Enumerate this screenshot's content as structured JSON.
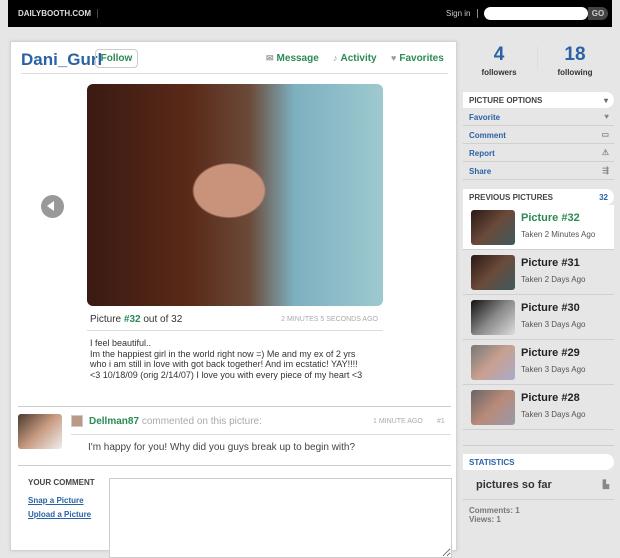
{
  "topbar": {
    "logo": "DAILYBOOTH.COM",
    "signin": "Sign in",
    "search_placeholder": "",
    "go": "GO"
  },
  "profile": {
    "username": "Dani_Gurl",
    "follow": "Follow",
    "nav": {
      "message": "Message",
      "activity": "Activity",
      "favorites": "Favorites"
    }
  },
  "picture": {
    "prefix": "Picture",
    "number": "#32",
    "suffix": "out of 32",
    "ago": "2 MINUTES 5 SECONDS AGO",
    "caption": [
      "I feel beautiful..",
      "Im the happiest girl in the world right now =) Me and my ex of 2 yrs",
      "who i am still in love with got back together! And im ecstatic! YAY!!!!",
      "<3 10/18/09 (orig 2/14/07) I love you with every piece of my heart <3"
    ]
  },
  "comment": {
    "user": "Dellman87",
    "action": "commented on this picture:",
    "ago": "1 MINUTE AGO",
    "num": "#1",
    "text": "I'm happy for you! Why did you guys break up to begin with?"
  },
  "your_comment": {
    "title": "YOUR COMMENT",
    "snap": "Snap a Picture",
    "upload": "Upload a Picture"
  },
  "stats": {
    "followers": "4",
    "followers_label": "followers",
    "following": "18",
    "following_label": "following"
  },
  "options": {
    "title": "PICTURE OPTIONS",
    "items": [
      "Favorite",
      "Comment",
      "Report",
      "Share"
    ]
  },
  "previous": {
    "title": "PREVIOUS PICTURES",
    "count": "32",
    "items": [
      {
        "title": "Picture #32",
        "taken": "Taken 2 Minutes Ago"
      },
      {
        "title": "Picture #31",
        "taken": "Taken 2 Days Ago"
      },
      {
        "title": "Picture #30",
        "taken": "Taken 3 Days Ago"
      },
      {
        "title": "Picture #29",
        "taken": "Taken 3 Days Ago"
      },
      {
        "title": "Picture #28",
        "taken": "Taken 3 Days Ago"
      }
    ]
  },
  "statistics": {
    "title": "STATISTICS",
    "pictures": "pictures so far",
    "comments": "Comments: 1",
    "views": "Views: 1"
  }
}
